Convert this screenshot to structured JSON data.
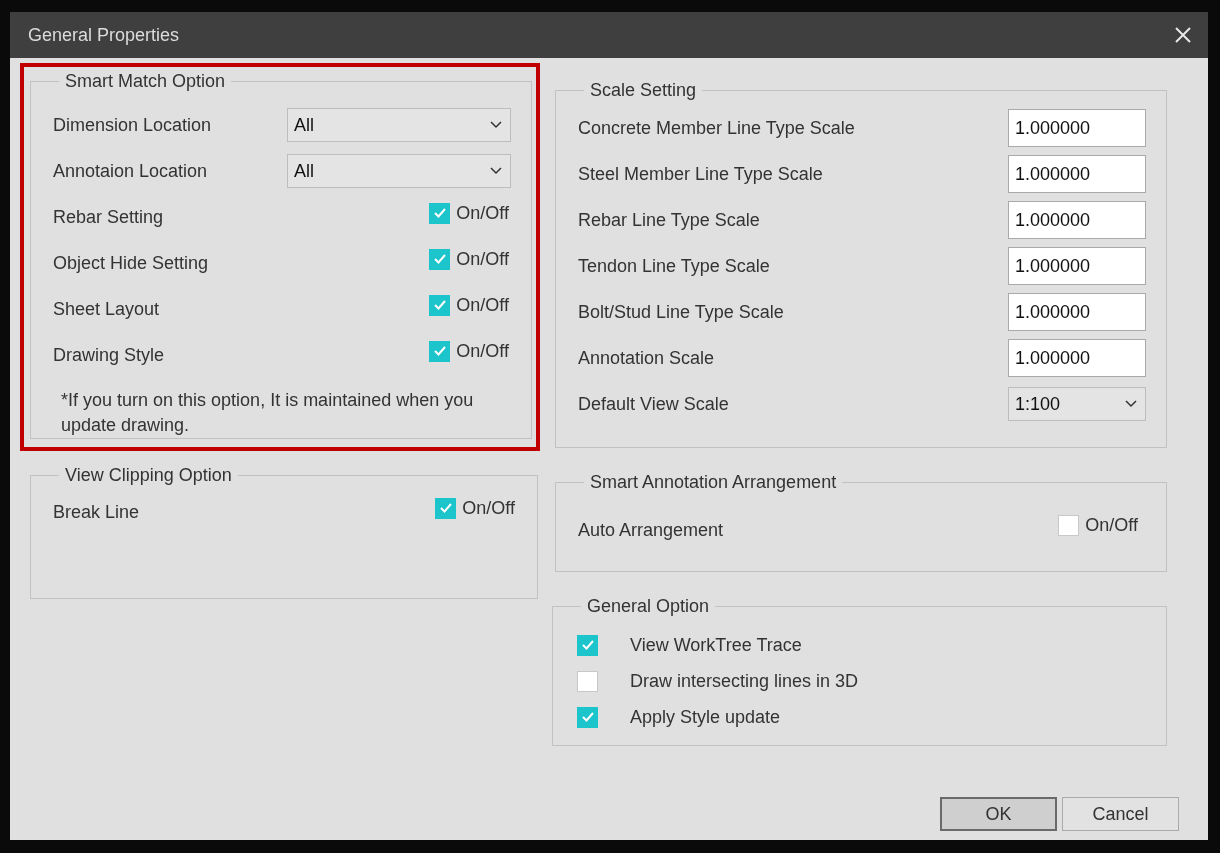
{
  "window": {
    "title": "General Properties"
  },
  "left_groups": [
    {
      "title": "Smart Match Option",
      "highlighted": true,
      "rows": [
        {
          "kind": "dropdown",
          "label": "Dimension Location",
          "value": "All"
        },
        {
          "kind": "dropdown",
          "label": "Annotaion Location",
          "value": "All"
        },
        {
          "kind": "toggle",
          "label": "Rebar Setting",
          "checked": true,
          "option": "On/Off"
        },
        {
          "kind": "toggle",
          "label": "Object Hide Setting",
          "checked": true,
          "option": "On/Off"
        },
        {
          "kind": "toggle",
          "label": "Sheet Layout",
          "checked": true,
          "option": "On/Off"
        },
        {
          "kind": "toggle",
          "label": "Drawing Style",
          "checked": true,
          "option": "On/Off"
        }
      ],
      "note": "*If you turn on this option, It is maintained when you update drawing."
    },
    {
      "title": "View Clipping Option",
      "highlighted": false,
      "rows": [
        {
          "kind": "toggle",
          "label": "Break Line",
          "checked": true,
          "option": "On/Off"
        }
      ]
    }
  ],
  "right_groups": [
    {
      "title": "Scale Setting",
      "highlighted": false,
      "rows": [
        {
          "kind": "input",
          "label": "Concrete Member Line Type Scale",
          "value": "1.000000"
        },
        {
          "kind": "input",
          "label": "Steel Member Line Type Scale",
          "value": "1.000000"
        },
        {
          "kind": "input",
          "label": "Rebar Line Type Scale",
          "value": "1.000000"
        },
        {
          "kind": "input",
          "label": "Tendon Line Type Scale",
          "value": "1.000000"
        },
        {
          "kind": "input",
          "label": "Bolt/Stud Line Type Scale",
          "value": "1.000000"
        },
        {
          "kind": "input",
          "label": "Annotation Scale",
          "value": "1.000000"
        },
        {
          "kind": "dropdown",
          "label": "Default View Scale",
          "value": "1:100"
        }
      ]
    },
    {
      "title": "Smart Annotation Arrangement",
      "highlighted": false,
      "rows": [
        {
          "kind": "toggle",
          "label": "Auto Arrangement",
          "checked": false,
          "option": "On/Off"
        }
      ]
    },
    {
      "title": "General Option",
      "highlighted": false,
      "rows": [
        {
          "kind": "check",
          "label": "View WorkTree Trace",
          "checked": true
        },
        {
          "kind": "check",
          "label": "Draw intersecting lines in 3D",
          "checked": false
        },
        {
          "kind": "check",
          "label": "Apply Style update",
          "checked": true
        }
      ]
    }
  ],
  "buttons": [
    {
      "label": "OK",
      "default": true
    },
    {
      "label": "Cancel",
      "default": false
    }
  ]
}
